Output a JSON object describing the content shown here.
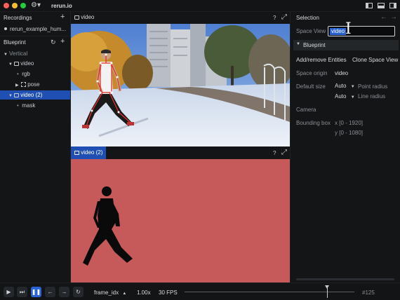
{
  "app": {
    "title": "rerun.io"
  },
  "recordings": {
    "header": "Recordings",
    "add": "+",
    "item": "rerun_example_hum..."
  },
  "blueprint": {
    "header": "Blueprint",
    "root": "Vertical",
    "items": [
      {
        "label": "video"
      },
      {
        "label": "rgb"
      },
      {
        "label": "pose"
      },
      {
        "label": "video (2)"
      },
      {
        "label": "mask"
      }
    ]
  },
  "views": {
    "top": {
      "tab": "video",
      "help": "?",
      "expand": "⤢"
    },
    "bottom": {
      "tab": "video (2)",
      "help": "?",
      "expand": "⤢"
    }
  },
  "selection": {
    "header": "Selection",
    "space_view_label": "Space View",
    "space_view_value": "video",
    "blueprint_section": "Blueprint",
    "add_remove": "Add/remove Entities",
    "clone": "Clone Space View",
    "space_origin_label": "Space origin",
    "space_origin_value": "video",
    "default_size_label": "Default size",
    "point_radius_value": "Auto",
    "point_radius_label": "Point radius",
    "line_radius_value": "Auto",
    "line_radius_label": "Line radius",
    "camera_label": "Camera",
    "bbox_label": "Bounding box",
    "bbox_x": "x [0 - 1920]",
    "bbox_y": "y [0 - 1080]"
  },
  "timeline": {
    "timeline_name": "frame_idx",
    "speed": "1.00x",
    "fps": "30 FPS",
    "frame": "#125",
    "progress": 0.84
  },
  "colors": {
    "accent": "#2a63d6",
    "mask_bg": "#c65a5a",
    "panel": "#131517"
  }
}
